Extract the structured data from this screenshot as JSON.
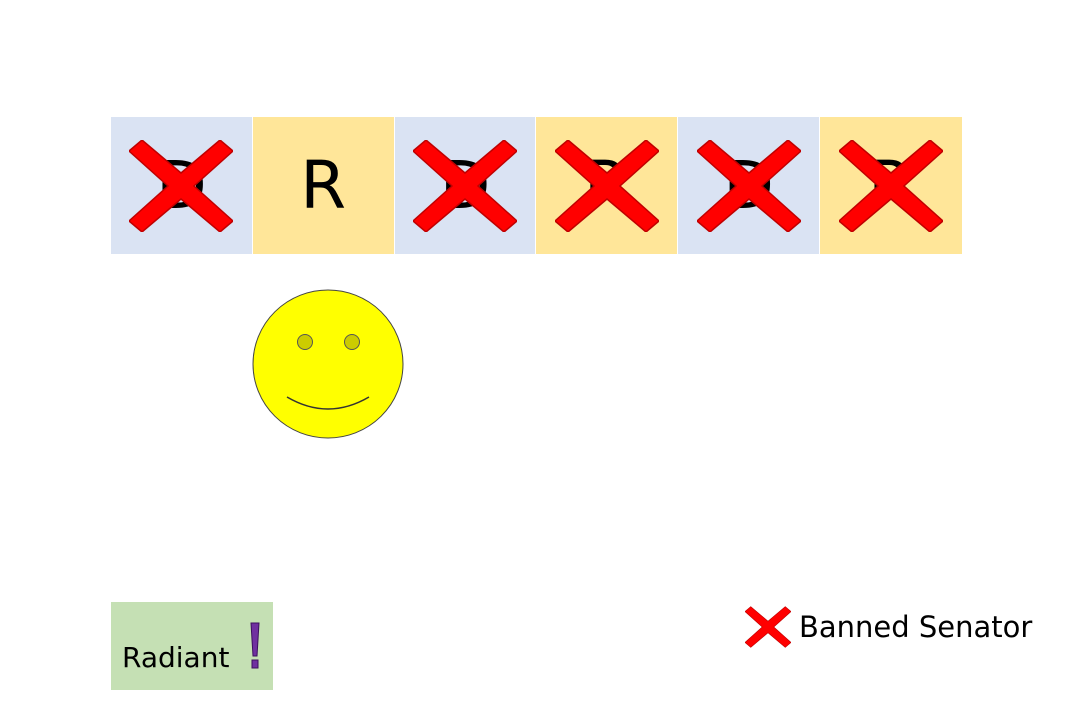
{
  "colors": {
    "party_d_bg": "#dae3f3",
    "party_r_bg": "#ffe699",
    "ban_fill": "#ff0000",
    "ban_stroke": "#c00000",
    "smiley_fill": "#ffff00",
    "smiley_eye": "#cccc00",
    "radiant_bg": "#c5e0b4",
    "exclaim_fill": "#7030a0"
  },
  "senators": [
    {
      "party": "D",
      "banned": true
    },
    {
      "party": "R",
      "banned": false
    },
    {
      "party": "D",
      "banned": true
    },
    {
      "party": "R",
      "banned": true
    },
    {
      "party": "D",
      "banned": true
    },
    {
      "party": "R",
      "banned": true
    }
  ],
  "active_senator_index": 1,
  "result": {
    "label": "Radiant"
  },
  "legend": {
    "label": "Banned Senator",
    "icon": "x-icon"
  }
}
